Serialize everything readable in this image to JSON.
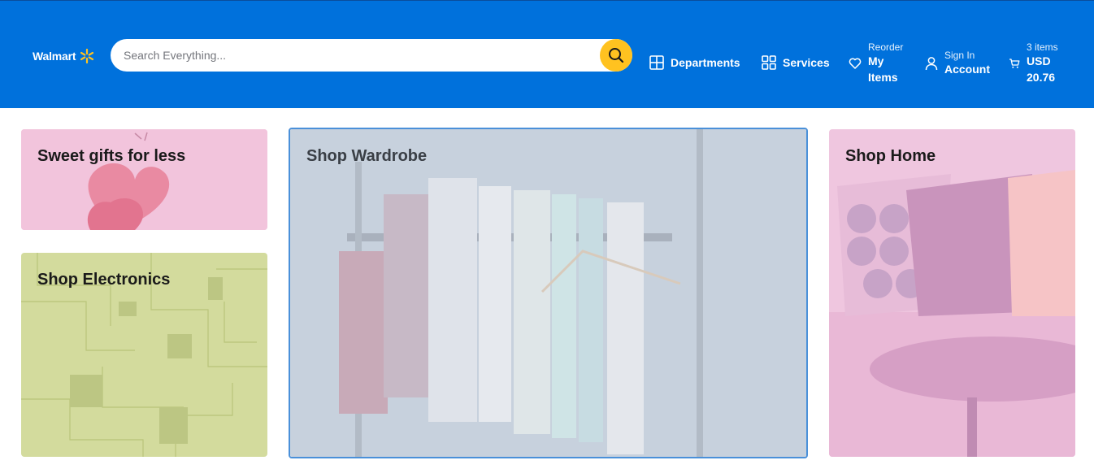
{
  "header": {
    "logo_text": "Walmart",
    "search_placeholder": "Search Everything...",
    "departments_label": "Departments",
    "services_label": "Services",
    "reorder_small": "Reorder",
    "reorder_line1": "My",
    "reorder_line2": "Items",
    "signin_small": "Sign In",
    "signin_label": "Account",
    "cart_small": "3 items",
    "cart_line1": "USD",
    "cart_line2": "20.76",
    "brand_color": "#0071dc",
    "accent_color": "#ffc220"
  },
  "tiles": {
    "gifts": {
      "title": "Sweet gifts for less",
      "tint": "#f3c6dd"
    },
    "electronics": {
      "title": "Shop Electronics",
      "tint": "#d4dc9c"
    },
    "wardrobe": {
      "title": "Shop Wardrobe",
      "tint": "#c8d2de"
    },
    "home": {
      "title": "Shop Home",
      "tint": "#f0c6df"
    }
  }
}
